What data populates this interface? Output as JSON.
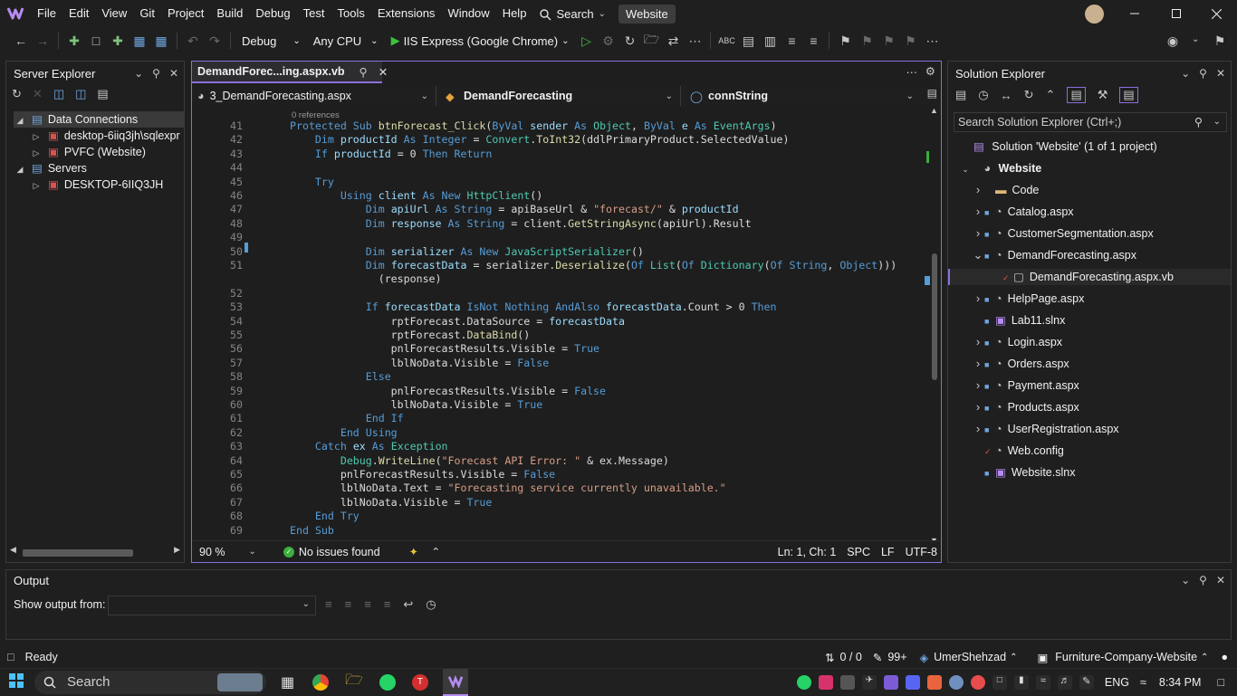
{
  "menu": {
    "items": [
      "File",
      "Edit",
      "View",
      "Git",
      "Project",
      "Build",
      "Debug",
      "Test",
      "Tools",
      "Extensions",
      "Window",
      "Help"
    ],
    "search_label": "Search",
    "solution_pill": "Website"
  },
  "toolbar": {
    "config": "Debug",
    "platform": "Any CPU",
    "run_target": "IIS Express (Google Chrome)"
  },
  "server_explorer": {
    "title": "Server Explorer",
    "items": [
      {
        "label": "Data Connections",
        "level": 0,
        "expanded": true
      },
      {
        "label": "desktop-6iiq3jh\\sqlexpr",
        "level": 1,
        "expanded": false
      },
      {
        "label": "PVFC (Website)",
        "level": 1,
        "expanded": false
      },
      {
        "label": "Servers",
        "level": 0,
        "expanded": true
      },
      {
        "label": "DESKTOP-6IIQ3JH",
        "level": 1,
        "expanded": false
      }
    ]
  },
  "editor": {
    "tab_title": "DemandForec...ing.aspx.vb",
    "nav_file": "3_DemandForecasting.aspx",
    "nav_class": "DemandForecasting",
    "nav_member": "connString",
    "codelens": "0 references",
    "lines": [
      {
        "n": "41",
        "t": [
          [
            "kw",
            "Protected Sub "
          ],
          [
            "fn",
            "btnForecast_Click"
          ],
          [
            "id",
            "("
          ],
          [
            "kw",
            "ByVal "
          ],
          [
            "var",
            "sender "
          ],
          [
            "kw",
            "As "
          ],
          [
            "ty",
            "Object"
          ],
          [
            "id",
            ", "
          ],
          [
            "kw",
            "ByVal "
          ],
          [
            "var",
            "e "
          ],
          [
            "kw",
            "As "
          ],
          [
            "ty",
            "EventArgs"
          ],
          [
            "id",
            ")"
          ]
        ]
      },
      {
        "n": "42",
        "t": [
          [
            "id",
            "    "
          ],
          [
            "kw",
            "Dim "
          ],
          [
            "var",
            "productId "
          ],
          [
            "kw",
            "As "
          ],
          [
            "kw",
            "Integer "
          ],
          [
            "id",
            "= "
          ],
          [
            "ty",
            "Convert"
          ],
          [
            "id",
            "."
          ],
          [
            "fn",
            "ToInt32"
          ],
          [
            "id",
            "(ddlPrimaryProduct.SelectedValue)"
          ]
        ]
      },
      {
        "n": "43",
        "t": [
          [
            "id",
            "    "
          ],
          [
            "kw",
            "If "
          ],
          [
            "var",
            "productId "
          ],
          [
            "id",
            "= 0 "
          ],
          [
            "kw",
            "Then Return"
          ]
        ]
      },
      {
        "n": "44",
        "t": []
      },
      {
        "n": "45",
        "t": [
          [
            "id",
            "    "
          ],
          [
            "kw",
            "Try"
          ]
        ]
      },
      {
        "n": "46",
        "t": [
          [
            "id",
            "        "
          ],
          [
            "kw",
            "Using "
          ],
          [
            "var",
            "client "
          ],
          [
            "kw",
            "As New "
          ],
          [
            "ty",
            "HttpClient"
          ],
          [
            "id",
            "()"
          ]
        ]
      },
      {
        "n": "47",
        "t": [
          [
            "id",
            "            "
          ],
          [
            "kw",
            "Dim "
          ],
          [
            "var",
            "apiUrl "
          ],
          [
            "kw",
            "As String "
          ],
          [
            "id",
            "= apiBaseUrl & "
          ],
          [
            "st",
            "\"forecast/\""
          ],
          [
            "id",
            " & "
          ],
          [
            "var",
            "productId"
          ]
        ]
      },
      {
        "n": "48",
        "t": [
          [
            "id",
            "            "
          ],
          [
            "kw",
            "Dim "
          ],
          [
            "var",
            "response "
          ],
          [
            "kw",
            "As String "
          ],
          [
            "id",
            "= client."
          ],
          [
            "fn",
            "GetStringAsync"
          ],
          [
            "id",
            "(apiUrl).Result"
          ]
        ]
      },
      {
        "n": "49",
        "t": []
      },
      {
        "n": "50",
        "t": [
          [
            "id",
            "            "
          ],
          [
            "kw",
            "Dim "
          ],
          [
            "var",
            "serializer "
          ],
          [
            "kw",
            "As New "
          ],
          [
            "ty",
            "JavaScriptSerializer"
          ],
          [
            "id",
            "()"
          ]
        ]
      },
      {
        "n": "51",
        "t": [
          [
            "id",
            "            "
          ],
          [
            "kw",
            "Dim "
          ],
          [
            "var",
            "forecastData "
          ],
          [
            "id",
            "= serializer."
          ],
          [
            "fn",
            "Deserialize"
          ],
          [
            "id",
            "("
          ],
          [
            "kw",
            "Of "
          ],
          [
            "ty",
            "List"
          ],
          [
            "id",
            "("
          ],
          [
            "kw",
            "Of "
          ],
          [
            "ty",
            "Dictionary"
          ],
          [
            "id",
            "("
          ],
          [
            "kw",
            "Of String"
          ],
          [
            "id",
            ", "
          ],
          [
            "kw",
            "Object"
          ],
          [
            "id",
            ")))"
          ]
        ]
      },
      {
        "n": "",
        "t": [
          [
            "id",
            "              (response)"
          ]
        ]
      },
      {
        "n": "52",
        "t": []
      },
      {
        "n": "53",
        "t": [
          [
            "id",
            "            "
          ],
          [
            "kw",
            "If "
          ],
          [
            "var",
            "forecastData "
          ],
          [
            "kw",
            "IsNot Nothing AndAlso "
          ],
          [
            "var",
            "forecastData"
          ],
          [
            "id",
            ".Count > 0 "
          ],
          [
            "kw",
            "Then"
          ]
        ]
      },
      {
        "n": "54",
        "t": [
          [
            "id",
            "                rptForecast.DataSource = "
          ],
          [
            "var",
            "forecastData"
          ]
        ]
      },
      {
        "n": "55",
        "t": [
          [
            "id",
            "                rptForecast."
          ],
          [
            "fn",
            "DataBind"
          ],
          [
            "id",
            "()"
          ]
        ]
      },
      {
        "n": "56",
        "t": [
          [
            "id",
            "                pnlForecastResults.Visible = "
          ],
          [
            "kw",
            "True"
          ]
        ]
      },
      {
        "n": "57",
        "t": [
          [
            "id",
            "                lblNoData.Visible = "
          ],
          [
            "kw",
            "False"
          ]
        ]
      },
      {
        "n": "58",
        "t": [
          [
            "id",
            "            "
          ],
          [
            "kw",
            "Else"
          ]
        ]
      },
      {
        "n": "59",
        "t": [
          [
            "id",
            "                pnlForecastResults.Visible = "
          ],
          [
            "kw",
            "False"
          ]
        ]
      },
      {
        "n": "60",
        "t": [
          [
            "id",
            "                lblNoData.Visible = "
          ],
          [
            "kw",
            "True"
          ]
        ]
      },
      {
        "n": "61",
        "t": [
          [
            "id",
            "            "
          ],
          [
            "kw",
            "End If"
          ]
        ]
      },
      {
        "n": "62",
        "t": [
          [
            "id",
            "        "
          ],
          [
            "kw",
            "End Using"
          ]
        ]
      },
      {
        "n": "63",
        "t": [
          [
            "id",
            "    "
          ],
          [
            "kw",
            "Catch "
          ],
          [
            "var",
            "ex "
          ],
          [
            "kw",
            "As "
          ],
          [
            "ty",
            "Exception"
          ]
        ]
      },
      {
        "n": "64",
        "t": [
          [
            "id",
            "        "
          ],
          [
            "ty",
            "Debug"
          ],
          [
            "id",
            "."
          ],
          [
            "fn",
            "WriteLine"
          ],
          [
            "id",
            "("
          ],
          [
            "st",
            "\"Forecast API Error: \""
          ],
          [
            "id",
            " & ex.Message)"
          ]
        ]
      },
      {
        "n": "65",
        "t": [
          [
            "id",
            "        pnlForecastResults.Visible = "
          ],
          [
            "kw",
            "False"
          ]
        ]
      },
      {
        "n": "66",
        "t": [
          [
            "id",
            "        lblNoData.Text = "
          ],
          [
            "st",
            "\"Forecasting service currently unavailable.\""
          ]
        ]
      },
      {
        "n": "67",
        "t": [
          [
            "id",
            "        lblNoData.Visible = "
          ],
          [
            "kw",
            "True"
          ]
        ]
      },
      {
        "n": "68",
        "t": [
          [
            "id",
            "    "
          ],
          [
            "kw",
            "End Try"
          ]
        ]
      },
      {
        "n": "69",
        "t": [
          [
            "kw",
            "End Sub"
          ]
        ]
      }
    ],
    "zoom": "90 %",
    "issues": "No issues found",
    "position": "Ln: 1, Ch: 1",
    "whitespace": "SPC",
    "line_ending": "LF",
    "encoding": "UTF-8"
  },
  "solution_explorer": {
    "title": "Solution Explorer",
    "search_placeholder": "Search Solution Explorer (Ctrl+;)",
    "solution_label": "Solution 'Website' (1 of 1 project)",
    "project": "Website",
    "items": [
      {
        "label": "Code",
        "kind": "folder",
        "arrow": true
      },
      {
        "label": "Catalog.aspx",
        "kind": "page",
        "arrow": true
      },
      {
        "label": "CustomerSegmentation.aspx",
        "kind": "page",
        "arrow": true
      },
      {
        "label": "DemandForecasting.aspx",
        "kind": "page",
        "arrow": true,
        "expanded": true
      },
      {
        "label": "DemandForecasting.aspx.vb",
        "kind": "vb",
        "arrow": false,
        "child": true,
        "selected": true
      },
      {
        "label": "HelpPage.aspx",
        "kind": "page",
        "arrow": true
      },
      {
        "label": "Lab11.slnx",
        "kind": "sln",
        "arrow": false
      },
      {
        "label": "Login.aspx",
        "kind": "page",
        "arrow": true
      },
      {
        "label": "Orders.aspx",
        "kind": "page",
        "arrow": true
      },
      {
        "label": "Payment.aspx",
        "kind": "page",
        "arrow": true
      },
      {
        "label": "Products.aspx",
        "kind": "page",
        "arrow": true
      },
      {
        "label": "UserRegistration.aspx",
        "kind": "page",
        "arrow": true
      },
      {
        "label": "Web.config",
        "kind": "config",
        "arrow": false
      },
      {
        "label": "Website.slnx",
        "kind": "sln",
        "arrow": false
      }
    ]
  },
  "output": {
    "title": "Output",
    "show_from_label": "Show output from:"
  },
  "statusbar": {
    "ready": "Ready",
    "changes": "0 / 0",
    "edits": "99+",
    "user": "UmerShehzad",
    "repo": "Furniture-Company-Website"
  },
  "taskbar": {
    "search": "Search",
    "lang": "ENG",
    "time": "8:34 PM"
  }
}
